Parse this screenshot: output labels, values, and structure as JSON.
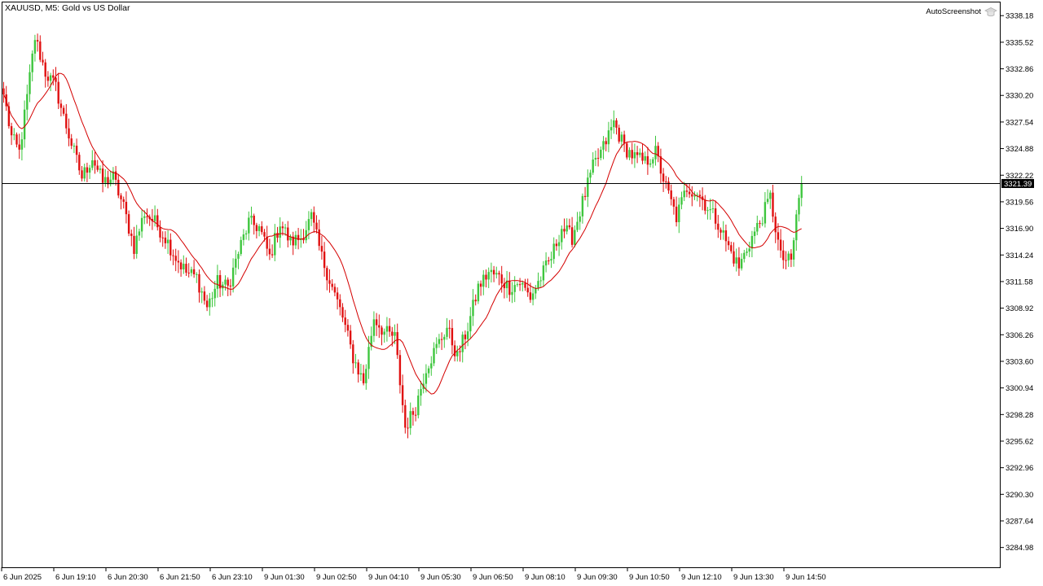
{
  "header": {
    "title": "XAUUSD, M5:  Gold vs US Dollar",
    "watermark": "AutoScreenshot",
    "watermark_icon": "graduation-cap-icon"
  },
  "colors": {
    "background": "#ffffff",
    "axis": "#000000",
    "bull": "#3ec63e",
    "bear": "#e01010",
    "ma": "#d40000",
    "price_line": "#000000",
    "price_tag": "#000000"
  },
  "chart_data": {
    "type": "candlestick",
    "symbol": "XAUUSD",
    "timeframe": "M5",
    "ylim": [
      3283.0,
      3339.5
    ],
    "grid": false,
    "current_price": 3321.39,
    "current_price_label": "3321.39",
    "y_ticks": [
      "3338.18",
      "3335.52",
      "3332.86",
      "3330.20",
      "3327.54",
      "3324.88",
      "3322.22",
      "3319.56",
      "3316.90",
      "3314.24",
      "3311.58",
      "3308.92",
      "3306.26",
      "3303.60",
      "3300.94",
      "3298.28",
      "3295.62",
      "3292.96",
      "3290.30",
      "3287.64",
      "3284.98"
    ],
    "x_ticks": [
      "6 Jun 2025",
      "6 Jun 19:10",
      "6 Jun 20:30",
      "6 Jun 21:50",
      "6 Jun 23:10",
      "9 Jun 01:30",
      "9 Jun 02:50",
      "9 Jun 04:10",
      "9 Jun 05:30",
      "9 Jun 06:50",
      "9 Jun 08:10",
      "9 Jun 09:30",
      "9 Jun 10:50",
      "9 Jun 12:10",
      "9 Jun 13:30",
      "9 Jun 14:50"
    ],
    "close_waypoints": [
      [
        0,
        3330.3
      ],
      [
        3,
        3326.0
      ],
      [
        6,
        3324.5
      ],
      [
        9,
        3330.0
      ],
      [
        12,
        3336.0
      ],
      [
        16,
        3332.5
      ],
      [
        20,
        3331.0
      ],
      [
        23,
        3328.0
      ],
      [
        27,
        3324.5
      ],
      [
        30,
        3322.0
      ],
      [
        34,
        3324.0
      ],
      [
        38,
        3321.5
      ],
      [
        42,
        3322.0
      ],
      [
        46,
        3319.0
      ],
      [
        50,
        3315.0
      ],
      [
        54,
        3318.5
      ],
      [
        58,
        3317.5
      ],
      [
        62,
        3316.0
      ],
      [
        66,
        3314.0
      ],
      [
        70,
        3312.5
      ],
      [
        74,
        3312.0
      ],
      [
        78,
        3309.0
      ],
      [
        82,
        3311.5
      ],
      [
        86,
        3311.0
      ],
      [
        90,
        3314.5
      ],
      [
        94,
        3317.5
      ],
      [
        98,
        3317.0
      ],
      [
        102,
        3314.0
      ],
      [
        106,
        3317.5
      ],
      [
        110,
        3315.5
      ],
      [
        114,
        3316.0
      ],
      [
        118,
        3318.0
      ],
      [
        122,
        3314.0
      ],
      [
        126,
        3311.0
      ],
      [
        130,
        3308.0
      ],
      [
        134,
        3304.0
      ],
      [
        138,
        3301.5
      ],
      [
        142,
        3308.0
      ],
      [
        146,
        3306.5
      ],
      [
        150,
        3306.0
      ],
      [
        154,
        3297.0
      ],
      [
        158,
        3299.0
      ],
      [
        162,
        3303.0
      ],
      [
        166,
        3305.0
      ],
      [
        170,
        3307.0
      ],
      [
        174,
        3304.0
      ],
      [
        178,
        3307.0
      ],
      [
        182,
        3311.0
      ],
      [
        186,
        3312.5
      ],
      [
        190,
        3312.0
      ],
      [
        194,
        3311.0
      ],
      [
        198,
        3311.5
      ],
      [
        202,
        3310.0
      ],
      [
        206,
        3312.0
      ],
      [
        210,
        3314.0
      ],
      [
        214,
        3317.0
      ],
      [
        218,
        3316.0
      ],
      [
        222,
        3319.5
      ],
      [
        226,
        3323.0
      ],
      [
        230,
        3325.0
      ],
      [
        234,
        3327.5
      ],
      [
        238,
        3325.0
      ],
      [
        242,
        3324.0
      ],
      [
        246,
        3323.5
      ],
      [
        250,
        3324.5
      ],
      [
        254,
        3321.0
      ],
      [
        258,
        3318.0
      ],
      [
        262,
        3321.0
      ],
      [
        266,
        3320.5
      ],
      [
        270,
        3319.0
      ],
      [
        274,
        3317.5
      ],
      [
        278,
        3315.0
      ],
      [
        282,
        3313.0
      ],
      [
        286,
        3315.5
      ],
      [
        290,
        3317.5
      ],
      [
        294,
        3320.0
      ],
      [
        298,
        3314.0
      ],
      [
        302,
        3313.5
      ],
      [
        304,
        3318.0
      ],
      [
        306,
        3321.8
      ]
    ]
  }
}
